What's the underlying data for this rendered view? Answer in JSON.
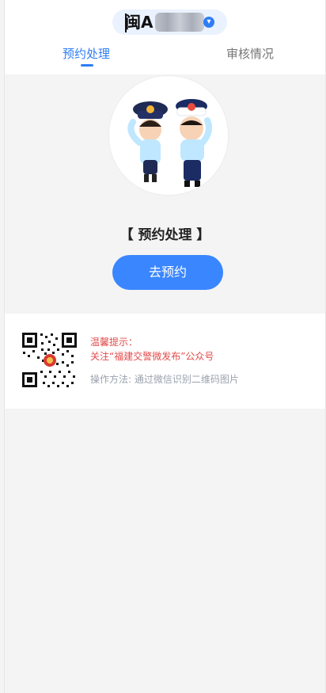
{
  "header": {
    "plate_text": "闽A",
    "tabs": [
      {
        "label": "预约处理",
        "active": true
      },
      {
        "label": "审核情况",
        "active": false
      }
    ]
  },
  "main": {
    "title": "【 预约处理 】",
    "cta_label": "去预约"
  },
  "tips": {
    "title": "温馨提示：",
    "follow": "关注“福建交警微发布”公众号",
    "method": "操作方法: 通过微信识别二维码图片"
  },
  "colors": {
    "accent": "#2f7df6",
    "button": "#3a86ff",
    "warning": "#e24b4b",
    "page_bg": "#f4f4f4"
  }
}
